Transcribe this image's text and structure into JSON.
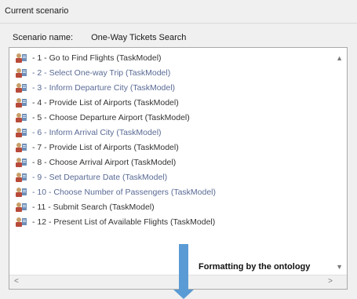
{
  "group": {
    "title": "Current scenario"
  },
  "scenario": {
    "name_label": "Scenario name:",
    "name_value": "One-Way Tickets Search"
  },
  "tasks": [
    {
      "label": "- 1 - Go to Find Flights (TaskModel)",
      "dim": false
    },
    {
      "label": "- 2 - Select One-way Trip (TaskModel)",
      "dim": true
    },
    {
      "label": "- 3 - Inform Departure City (TaskModel)",
      "dim": true
    },
    {
      "label": "- 4 - Provide List of Airports (TaskModel)",
      "dim": false
    },
    {
      "label": "- 5 - Choose Departure Airport (TaskModel)",
      "dim": false
    },
    {
      "label": "- 6 - Inform Arrival City (TaskModel)",
      "dim": true
    },
    {
      "label": "- 7 - Provide List of Airports (TaskModel)",
      "dim": false
    },
    {
      "label": "- 8 - Choose Arrival Airport (TaskModel)",
      "dim": false
    },
    {
      "label": "- 9 - Set Departure Date (TaskModel)",
      "dim": true
    },
    {
      "label": "- 10 - Choose Number of Passengers (TaskModel)",
      "dim": true
    },
    {
      "label": "- 11 - Submit Search (TaskModel)",
      "dim": false
    },
    {
      "label": "- 12 - Present List of Available Flights (TaskModel)",
      "dim": false
    }
  ],
  "overlay": {
    "caption": "Formatting by the ontology"
  },
  "icons": {
    "task": "task-model-icon",
    "scroll_up": "scroll-up-icon",
    "scroll_down": "scroll-down-icon",
    "scroll_left": "scroll-left-icon",
    "scroll_right": "scroll-right-icon",
    "arrow": "down-arrow-icon"
  },
  "colors": {
    "arrow": "#5b9bd5",
    "dim_text": "#596a95",
    "text": "#333333"
  }
}
